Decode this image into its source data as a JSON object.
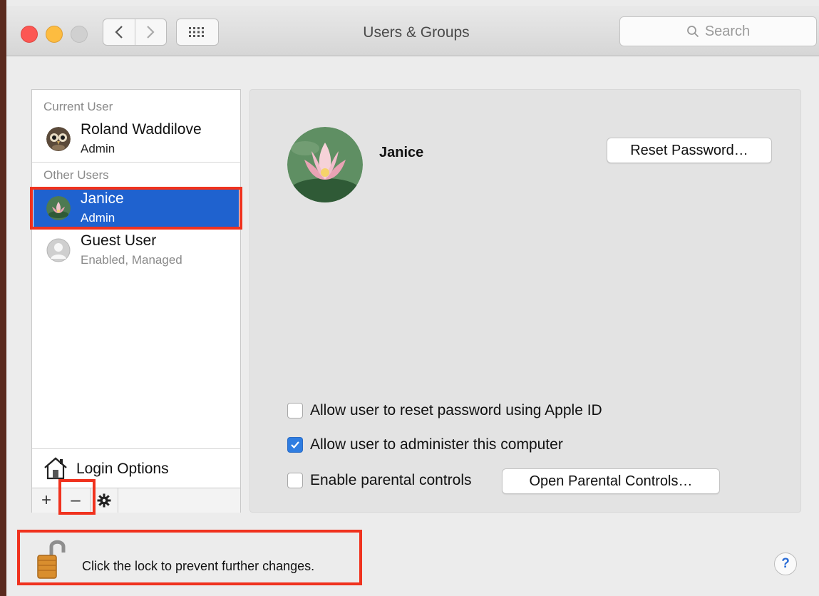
{
  "window": {
    "title": "Users & Groups"
  },
  "search": {
    "placeholder": "Search"
  },
  "sidebar": {
    "current_user_header": "Current User",
    "other_users_header": "Other Users",
    "users": [
      {
        "name": "Roland Waddilove",
        "role": "Admin",
        "avatar": "owl-avatar"
      },
      {
        "name": "Janice",
        "role": "Admin",
        "avatar": "lotus-avatar",
        "selected": true
      },
      {
        "name": "Guest User",
        "role": "Enabled, Managed",
        "avatar": "person-silhouette-icon"
      }
    ],
    "login_options_label": "Login Options",
    "toolbar": {
      "add": "+",
      "remove": "–"
    }
  },
  "detail": {
    "user_name": "Janice",
    "reset_password_label": "Reset Password…",
    "options": [
      {
        "label": "Allow user to reset password using Apple ID",
        "checked": false
      },
      {
        "label": "Allow user to administer this computer",
        "checked": true
      },
      {
        "label": "Enable parental controls",
        "checked": false
      }
    ],
    "open_parental_controls_label": "Open Parental Controls…"
  },
  "footer": {
    "lock_text": "Click the lock to prevent further changes.",
    "help_label": "?"
  },
  "colors": {
    "selection": "#1f62cf",
    "highlight": "#f0321e",
    "checkbox_checked": "#2f7de1"
  }
}
